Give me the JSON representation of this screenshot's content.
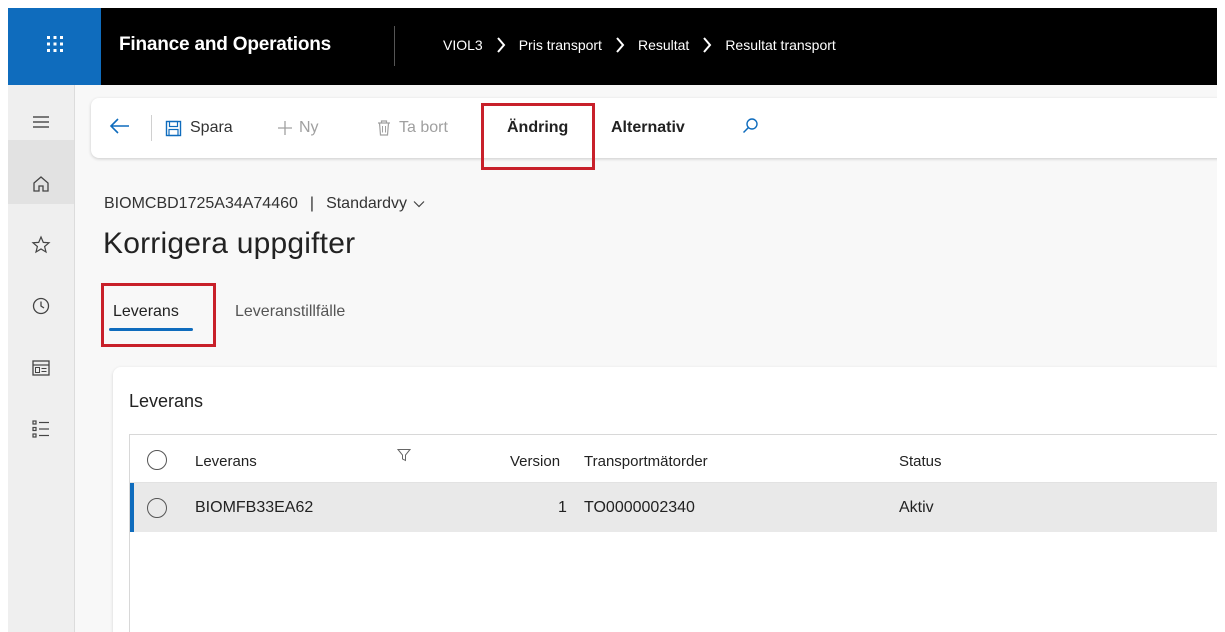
{
  "app": {
    "title": "Finance and Operations",
    "breadcrumbs": [
      "VIOL3",
      "Pris transport",
      "Resultat",
      "Resultat transport"
    ]
  },
  "actionbar": {
    "save_label": "Spara",
    "new_label": "Ny",
    "delete_label": "Ta bort",
    "change_label": "Ändring",
    "options_label": "Alternativ"
  },
  "record": {
    "id": "BIOMCBD1725A34A74460",
    "divider": "|",
    "view": "Standardvy"
  },
  "page": {
    "title": "Korrigera uppgifter"
  },
  "tabs": [
    {
      "label": "Leverans",
      "active": true
    },
    {
      "label": "Leveranstillfälle",
      "active": false
    }
  ],
  "section": {
    "title": "Leverans",
    "columns": {
      "leverans": "Leverans",
      "version": "Version",
      "order": "Transportmätorder",
      "status": "Status"
    },
    "rows": [
      {
        "leverans": "BIOMFB33EA62",
        "version": "1",
        "order": "TO0000002340",
        "status": "Aktiv"
      }
    ]
  },
  "colors": {
    "accent": "#0f6cbd",
    "highlight": "#c8202a",
    "topbar": "#000000"
  },
  "icons": [
    "waffle-icon",
    "hamburger-icon",
    "home-icon",
    "star-icon",
    "clock-icon",
    "workspace-icon",
    "modules-icon",
    "back-arrow-icon",
    "save-icon",
    "plus-icon",
    "trash-icon",
    "search-icon",
    "chevron-right-icon",
    "chevron-down-icon",
    "filter-icon",
    "radio-icon"
  ]
}
